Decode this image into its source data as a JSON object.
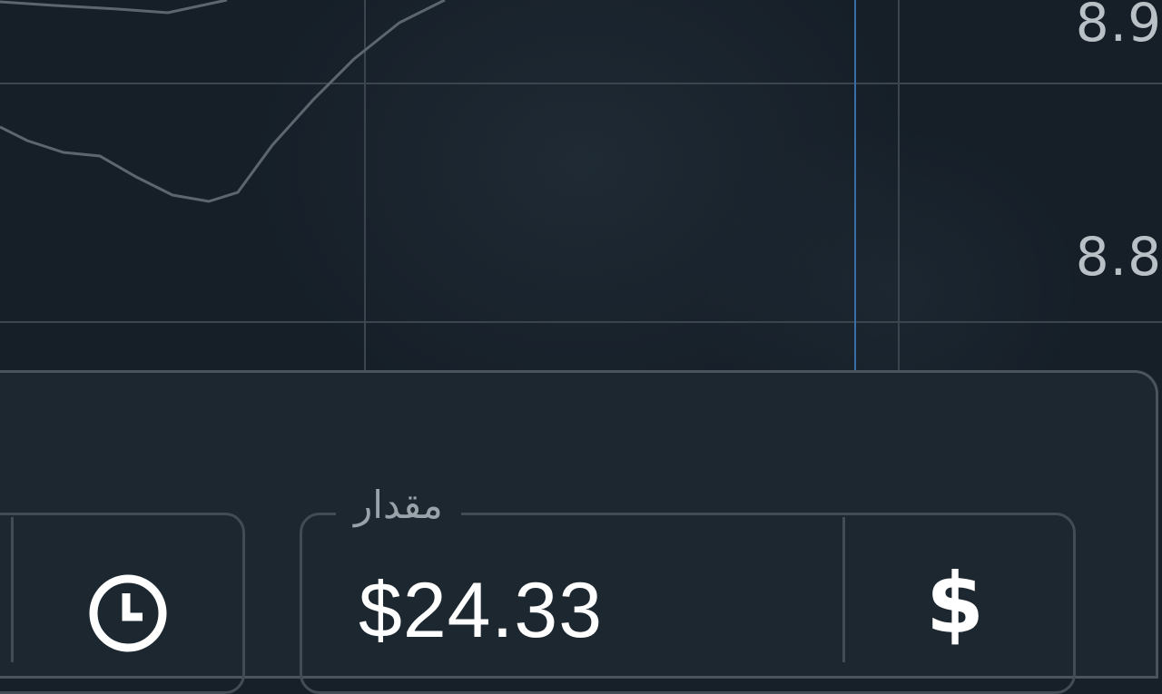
{
  "chart": {
    "price_labels": [
      "8.9",
      "8.8"
    ],
    "colors": {
      "grid": "#3b454e",
      "line": "#5d666e",
      "cursor": "#3a6ea8",
      "label": "#b9c0c6"
    }
  },
  "trade_panel": {
    "time_field": {
      "icon": "clock-icon"
    },
    "amount_field": {
      "label": "مقدار",
      "value": "$24.33",
      "currency_icon": "dollar-icon",
      "currency_symbol": "$"
    }
  }
}
